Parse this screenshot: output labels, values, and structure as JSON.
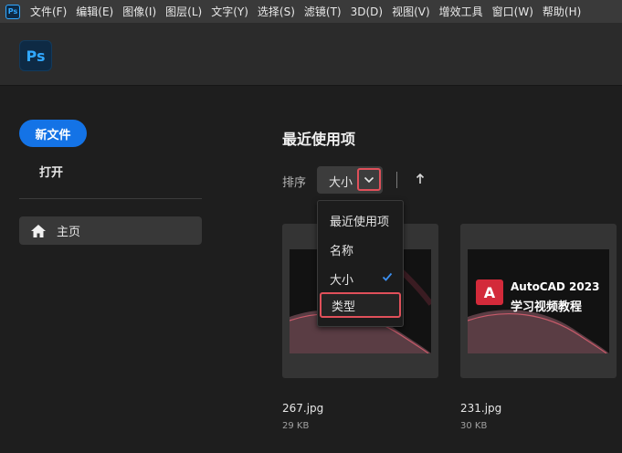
{
  "menubar": {
    "app_badge": "Ps",
    "items": [
      "文件(F)",
      "编辑(E)",
      "图像(I)",
      "图层(L)",
      "文字(Y)",
      "选择(S)",
      "滤镜(T)",
      "3D(D)",
      "视图(V)",
      "增效工具",
      "窗口(W)",
      "帮助(H)"
    ]
  },
  "header": {
    "logo_text": "Ps"
  },
  "sidebar": {
    "new_file": "新文件",
    "open": "打开",
    "nav": [
      {
        "label": "主页",
        "icon": "home-icon"
      }
    ]
  },
  "main": {
    "title": "最近使用项",
    "sort_label": "排序",
    "sort_value": "大小",
    "sort_direction_icon": "arrow-up-icon",
    "dropdown": {
      "options": [
        "最近使用项",
        "名称",
        "大小",
        "类型"
      ],
      "selected": "大小",
      "highlighted": "类型"
    },
    "files": [
      {
        "name": "267.jpg",
        "size": "29 KB"
      },
      {
        "name": "231.jpg",
        "size": "30 KB",
        "thumb_logo": "A",
        "thumb_line1": "AutoCAD 2023",
        "thumb_line2": "学习视频教程"
      }
    ]
  },
  "colors": {
    "accent": "#1473e6",
    "highlight_outline": "#e0505a",
    "check": "#3b8ef0",
    "autocad_red": "#d32a3a"
  }
}
